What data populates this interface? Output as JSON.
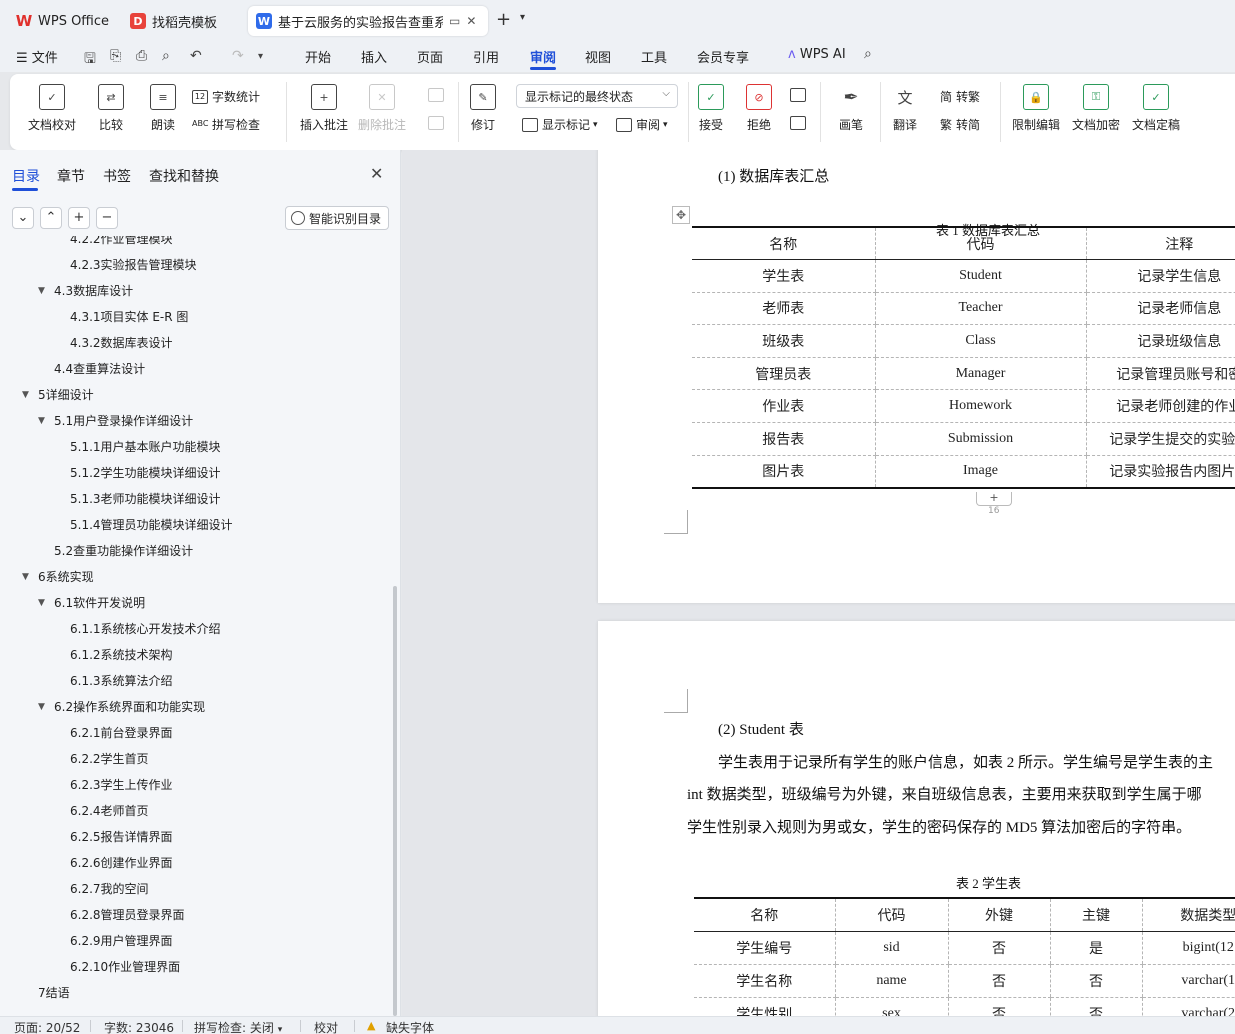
{
  "tabs": {
    "wps": "WPS Office",
    "daoke": "找稻壳模板",
    "doc": "基于云服务的实验报告查重系统"
  },
  "menu": {
    "file": "文件",
    "items": [
      "开始",
      "插入",
      "页面",
      "引用",
      "审阅",
      "视图",
      "工具",
      "会员专享"
    ],
    "active": "审阅",
    "ai": "WPS AI"
  },
  "ribbon": {
    "doc_check": "文档校对",
    "compare": "比较",
    "read": "朗读",
    "word_count": "字数统计",
    "spell_check": "拼写检查",
    "insert_comment": "插入批注",
    "delete_comment": "删除批注",
    "revise": "修订",
    "markup_state": "显示标记的最终状态",
    "show_markup": "显示标记",
    "review": "审阅",
    "accept": "接受",
    "reject": "拒绝",
    "pen": "画笔",
    "translate": "翻译",
    "to_traditional": "转繁",
    "to_simplified": "转简",
    "restrict_edit": "限制编辑",
    "encrypt": "文档加密",
    "finalize": "文档定稿"
  },
  "sidebar": {
    "tabs": [
      "目录",
      "章节",
      "书签",
      "查找和替换"
    ],
    "smart_toc": "智能识别目录",
    "toc": [
      {
        "text": "4.2.2作业管理模块",
        "level": 3,
        "caret": false
      },
      {
        "text": "4.2.3实验报告管理模块",
        "level": 3,
        "caret": false
      },
      {
        "text": "4.3数据库设计",
        "level": 2,
        "caret": true
      },
      {
        "text": "4.3.1项目实体 E-R 图",
        "level": 3,
        "caret": false
      },
      {
        "text": "4.3.2数据库表设计",
        "level": 3,
        "caret": false
      },
      {
        "text": "4.4查重算法设计",
        "level": 2,
        "caret": false
      },
      {
        "text": "5详细设计",
        "level": 1,
        "caret": true
      },
      {
        "text": "5.1用户登录操作详细设计",
        "level": 2,
        "caret": true
      },
      {
        "text": "5.1.1用户基本账户功能模块",
        "level": 3,
        "caret": false
      },
      {
        "text": "5.1.2学生功能模块详细设计",
        "level": 3,
        "caret": false
      },
      {
        "text": "5.1.3老师功能模块详细设计",
        "level": 3,
        "caret": false
      },
      {
        "text": "5.1.4管理员功能模块详细设计",
        "level": 3,
        "caret": false
      },
      {
        "text": "5.2查重功能操作详细设计",
        "level": 2,
        "caret": false
      },
      {
        "text": "6系统实现",
        "level": 1,
        "caret": true
      },
      {
        "text": "6.1软件开发说明",
        "level": 2,
        "caret": true
      },
      {
        "text": "6.1.1系统核心开发技术介绍",
        "level": 3,
        "caret": false
      },
      {
        "text": "6.1.2系统技术架构",
        "level": 3,
        "caret": false
      },
      {
        "text": "6.1.3系统算法介绍",
        "level": 3,
        "caret": false
      },
      {
        "text": "6.2操作系统界面和功能实现",
        "level": 2,
        "caret": true
      },
      {
        "text": "6.2.1前台登录界面",
        "level": 3,
        "caret": false
      },
      {
        "text": "6.2.2学生首页",
        "level": 3,
        "caret": false
      },
      {
        "text": "6.2.3学生上传作业",
        "level": 3,
        "caret": false
      },
      {
        "text": "6.2.4老师首页",
        "level": 3,
        "caret": false
      },
      {
        "text": "6.2.5报告详情界面",
        "level": 3,
        "caret": false
      },
      {
        "text": "6.2.6创建作业界面",
        "level": 3,
        "caret": false
      },
      {
        "text": "6.2.7我的空间",
        "level": 3,
        "caret": false
      },
      {
        "text": "6.2.8管理员登录界面",
        "level": 3,
        "caret": false
      },
      {
        "text": "6.2.9用户管理界面",
        "level": 3,
        "caret": false
      },
      {
        "text": "6.2.10作业管理界面",
        "level": 3,
        "caret": false
      },
      {
        "text": "7结语",
        "level": 1,
        "caret": false
      }
    ]
  },
  "document": {
    "heading1": "(1) 数据库表汇总",
    "table1_caption": "表 1 数据库表汇总",
    "table1": [
      [
        "名称",
        "代码",
        "注释"
      ],
      [
        "学生表",
        "Student",
        "记录学生信息"
      ],
      [
        "老师表",
        "Teacher",
        "记录老师信息"
      ],
      [
        "班级表",
        "Class",
        "记录班级信息"
      ],
      [
        "管理员表",
        "Manager",
        "记录管理员账号和密"
      ],
      [
        "作业表",
        "Homework",
        "记录老师创建的作业"
      ],
      [
        "报告表",
        "Submission",
        "记录学生提交的实验报"
      ],
      [
        "图片表",
        "Image",
        "记录实验报告内图片的"
      ]
    ],
    "page_number": "16",
    "heading2": "(2) Student 表",
    "para_line1": "学生表用于记录所有学生的账户信息，如表 2 所示。学生编号是学生表的主",
    "para_line2": "int 数据类型，班级编号为外键，来自班级信息表，主要用来获取到学生属于哪",
    "para_line3": "学生性别录入规则为男或女，学生的密码保存的 MD5 算法加密后的字符串。",
    "table2_caption": "表 2 学生表",
    "table2": [
      [
        "名称",
        "代码",
        "外键",
        "主键",
        "数据类型"
      ],
      [
        "学生编号",
        "sid",
        "否",
        "是",
        "bigint(12"
      ],
      [
        "学生名称",
        "name",
        "否",
        "否",
        "varchar(1"
      ],
      [
        "学生性别",
        "sex",
        "否",
        "否",
        "varchar(2"
      ]
    ]
  },
  "status": {
    "page": "页面: 20/52",
    "words": "字数: 23046",
    "spell": "拼写检查: 关闭",
    "proof": "校对",
    "missing_font": "缺失字体"
  }
}
